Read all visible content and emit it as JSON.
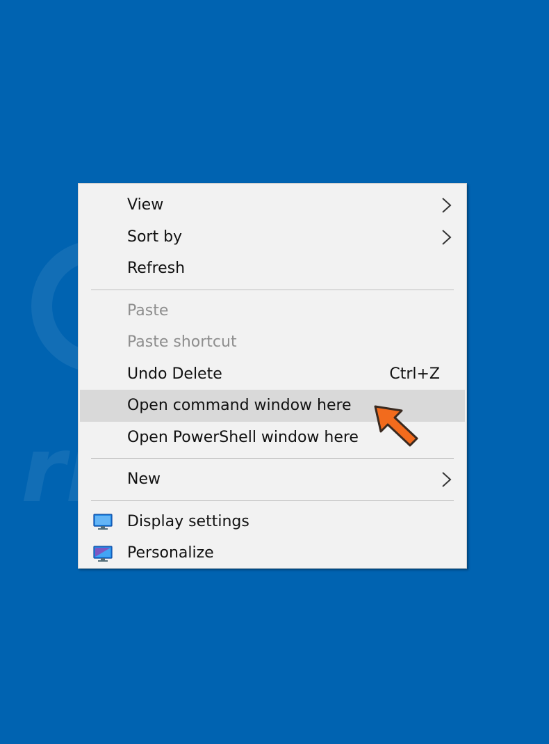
{
  "menu": {
    "items": [
      {
        "label": "View",
        "submenu": true
      },
      {
        "label": "Sort by",
        "submenu": true
      },
      {
        "label": "Refresh"
      },
      {
        "label": "Paste",
        "disabled": true
      },
      {
        "label": "Paste shortcut",
        "disabled": true
      },
      {
        "label": "Undo Delete",
        "shortcut": "Ctrl+Z"
      },
      {
        "label": "Open command window here",
        "highlighted": true
      },
      {
        "label": "Open PowerShell window here"
      },
      {
        "label": "New",
        "submenu": true
      },
      {
        "label": "Display settings",
        "icon": "display-settings-icon"
      },
      {
        "label": "Personalize",
        "icon": "personalize-icon"
      }
    ]
  },
  "colors": {
    "desktop_background": "#0063b1",
    "menu_background": "#f2f2f2",
    "highlight": "#d9d9d9",
    "disabled_text": "#8e8e8e",
    "pointer_arrow": "#f26b1d"
  },
  "watermark": {
    "text": "PC risk.com"
  }
}
